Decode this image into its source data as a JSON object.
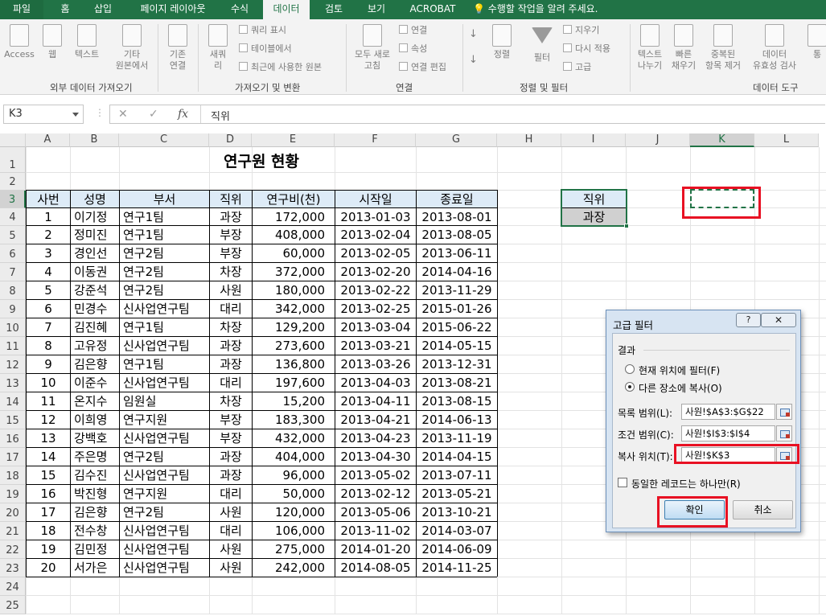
{
  "ribbon_tabs": [
    "파일",
    "홈",
    "삽입",
    "페이지 레이아웃",
    "수식",
    "데이터",
    "검토",
    "보기",
    "ACROBAT"
  ],
  "tell_me": "수행할 작업을 알려 주세요.",
  "ribbon": {
    "access": "Access",
    "web": "웹",
    "text": "텍스트",
    "other_line1": "기타",
    "other_line2": "원본에서",
    "existing_line1": "기존",
    "existing_line2": "연결",
    "new_query_line1": "새쿼",
    "new_query_line2": "리",
    "show_query": "쿼리 표시",
    "from_table": "테이블에서",
    "recent_sources": "최근에 사용한 원본",
    "refresh_line1": "모두 새로",
    "refresh_line2": "고침",
    "connections": "연결",
    "properties": "속성",
    "edit_links": "연결 편집",
    "sort": "정렬",
    "filter": "필터",
    "clear": "지우기",
    "reapply": "다시 적용",
    "advanced": "고급",
    "text_to_col_line1": "텍스트",
    "text_to_col_line2": "나누기",
    "flash_fill_line1": "빠른",
    "flash_fill_line2": "채우기",
    "remove_dup_line1": "중복된",
    "remove_dup_line2": "항목 제거",
    "validation_line1": "데이터",
    "validation_line2": "유효성 검사",
    "more": "통",
    "group_external": "외부 데이터 가져오기",
    "group_transform": "가져오기 및 변환",
    "group_connections": "연결",
    "group_sortfilter": "정렬 및 필터",
    "group_datatools": "데이터 도구"
  },
  "formula_bar": {
    "name_box": "K3",
    "cancel": "✕",
    "enter": "✓",
    "fx": "fx",
    "value": "직위"
  },
  "columns": [
    "A",
    "B",
    "C",
    "D",
    "E",
    "F",
    "G",
    "H",
    "I",
    "J",
    "K",
    "L"
  ],
  "rows": [
    "1",
    "2",
    "3",
    "4",
    "5",
    "6",
    "7",
    "8",
    "9",
    "10",
    "11",
    "12",
    "13",
    "14",
    "15",
    "16",
    "17",
    "18",
    "19",
    "20",
    "21",
    "22",
    "23",
    "24",
    "25"
  ],
  "sheet": {
    "title": "연구원 현황",
    "headers": [
      "사번",
      "성명",
      "부서",
      "직위",
      "연구비(천)",
      "시작일",
      "종료일"
    ],
    "records": [
      [
        "1",
        "이기정",
        "연구1팀",
        "과장",
        "172,000",
        "2013-01-03",
        "2013-08-01"
      ],
      [
        "2",
        "정미진",
        "연구1팀",
        "부장",
        "408,000",
        "2013-02-04",
        "2013-08-05"
      ],
      [
        "3",
        "경인선",
        "연구2팀",
        "부장",
        "60,000",
        "2013-02-05",
        "2013-06-11"
      ],
      [
        "4",
        "이동권",
        "연구2팀",
        "차장",
        "372,000",
        "2013-02-20",
        "2014-04-16"
      ],
      [
        "5",
        "강준석",
        "연구2팀",
        "사원",
        "180,000",
        "2013-02-22",
        "2013-11-29"
      ],
      [
        "6",
        "민경수",
        "신사업연구팀",
        "대리",
        "342,000",
        "2013-02-25",
        "2015-01-26"
      ],
      [
        "7",
        "김진혜",
        "연구1팀",
        "차장",
        "129,200",
        "2013-03-04",
        "2015-06-22"
      ],
      [
        "8",
        "고유정",
        "신사업연구팀",
        "과장",
        "273,600",
        "2013-03-21",
        "2014-05-15"
      ],
      [
        "9",
        "김은향",
        "연구1팀",
        "과장",
        "136,800",
        "2013-03-26",
        "2013-12-31"
      ],
      [
        "10",
        "이준수",
        "신사업연구팀",
        "대리",
        "197,600",
        "2013-04-03",
        "2013-08-21"
      ],
      [
        "11",
        "온지수",
        "임원실",
        "차장",
        "15,200",
        "2013-04-11",
        "2013-08-15"
      ],
      [
        "12",
        "이희영",
        "연구지원",
        "부장",
        "183,300",
        "2013-04-21",
        "2014-06-13"
      ],
      [
        "13",
        "강백호",
        "신사업연구팀",
        "부장",
        "432,000",
        "2013-04-23",
        "2013-11-19"
      ],
      [
        "14",
        "주은명",
        "연구2팀",
        "과장",
        "404,000",
        "2013-04-30",
        "2014-04-15"
      ],
      [
        "15",
        "김수진",
        "신사업연구팀",
        "과장",
        "96,000",
        "2013-05-02",
        "2013-07-11"
      ],
      [
        "16",
        "박진형",
        "연구지원",
        "대리",
        "50,000",
        "2013-02-12",
        "2013-05-21"
      ],
      [
        "17",
        "김은향",
        "연구2팀",
        "사원",
        "120,000",
        "2013-05-06",
        "2013-10-21"
      ],
      [
        "18",
        "전수창",
        "신사업연구팀",
        "대리",
        "106,000",
        "2013-11-02",
        "2014-03-07"
      ],
      [
        "19",
        "김민정",
        "신사업연구팀",
        "사원",
        "275,000",
        "2014-01-20",
        "2014-06-09"
      ],
      [
        "20",
        "서가은",
        "신사업연구팀",
        "사원",
        "242,000",
        "2014-08-05",
        "2014-11-25"
      ]
    ],
    "criteria_header": "직위",
    "criteria_value": "과장"
  },
  "dialog": {
    "title": "고급 필터",
    "help": "?",
    "close": "✕",
    "result_label": "결과",
    "option_inplace": "현재 위치에 필터(F)",
    "option_copy": "다른 장소에 복사(O)",
    "list_range_label": "목록 범위(L):",
    "list_range_value": "사원!$A$3:$G$22",
    "criteria_range_label": "조건 범위(C):",
    "criteria_range_value": "사원!$I$3:$I$4",
    "copy_to_label": "복사 위치(T):",
    "copy_to_value": "사원!$K$3",
    "unique_label": "동일한 레코드는 하나만(R)",
    "ok": "확인",
    "cancel": "취소"
  },
  "accent_color": "#217346",
  "highlight_color": "#e81123"
}
